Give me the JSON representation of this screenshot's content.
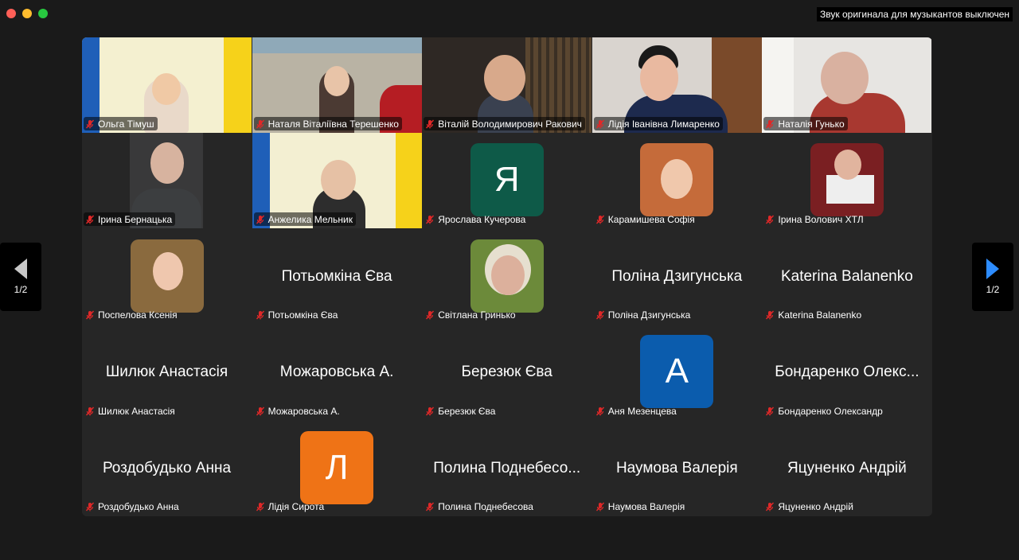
{
  "window": {
    "notice": "Звук оригинала для музыкантов выключен"
  },
  "pager": {
    "left_page": "1/2",
    "right_page": "1/2"
  },
  "colors": {
    "speaking_border": "#23c552",
    "mic_muted": "#e02828"
  },
  "tiles": [
    {
      "name": "Ольга Тімуш",
      "kind": "video"
    },
    {
      "name": "Наталя Віталіївна Терешенко",
      "kind": "video",
      "speaking": true
    },
    {
      "name": "Віталій Володимирович Ракович",
      "kind": "video"
    },
    {
      "name": "Лідія Іванівна Лимаренко",
      "kind": "video"
    },
    {
      "name": "Наталія Гунько",
      "kind": "video"
    },
    {
      "name": "Ірина Бернацька",
      "kind": "video"
    },
    {
      "name": "Анжелика Мельник",
      "kind": "video"
    },
    {
      "name": "Ярослава Кучерова",
      "kind": "letter",
      "letter": "Я",
      "avatar_color": "#0e5a48"
    },
    {
      "name": "Карамишева Софія",
      "kind": "photo"
    },
    {
      "name": "Ірина Волович ХТЛ",
      "kind": "photo"
    },
    {
      "name": "Поспелова Ксенія",
      "kind": "photo"
    },
    {
      "name": "Потьомкіна Єва",
      "kind": "text",
      "display": "Потьомкіна Єва"
    },
    {
      "name": "Світлана Гринько",
      "kind": "photo"
    },
    {
      "name": "Поліна Дзигунська",
      "kind": "text",
      "display": "Поліна Дзигунська"
    },
    {
      "name": "Katerina Balanenko",
      "kind": "text",
      "display": "Katerina Balanenko"
    },
    {
      "name": "Шилюк Анастасія",
      "kind": "text",
      "display": "Шилюк Анастасія"
    },
    {
      "name": "Можаровська А.",
      "kind": "text",
      "display": "Можаровська А."
    },
    {
      "name": "Березюк Єва",
      "kind": "text",
      "display": "Березюк Єва"
    },
    {
      "name": "Аня Мезенцева",
      "kind": "letter",
      "letter": "A",
      "avatar_color": "#0b5cad"
    },
    {
      "name": "Бондаренко Олександр",
      "kind": "text",
      "display": "Бондаренко Олекс..."
    },
    {
      "name": "Роздобудько Анна",
      "kind": "text",
      "display": "Роздобудько Анна"
    },
    {
      "name": "Лідія Сирота",
      "kind": "letter",
      "letter": "Л",
      "avatar_color": "#ef7316"
    },
    {
      "name": "Полина Поднебесова",
      "kind": "text",
      "display": "Полина Поднебесо..."
    },
    {
      "name": "Наумова Валерія",
      "kind": "text",
      "display": "Наумова Валерія"
    },
    {
      "name": "Яцуненко Андрій",
      "kind": "text",
      "display": "Яцуненко Андрій"
    }
  ]
}
